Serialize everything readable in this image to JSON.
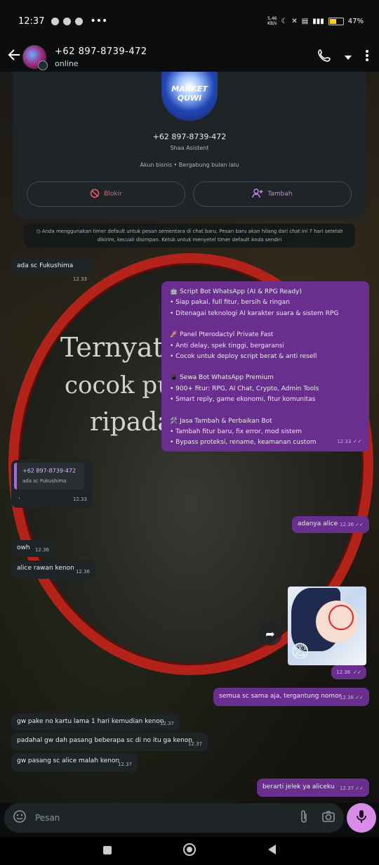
{
  "status_bar": {
    "time": "12:37",
    "network_speed": "5,46\nKB/s",
    "battery": "47%"
  },
  "header": {
    "contact": "+62 897-8739-472",
    "status": "online"
  },
  "business_card": {
    "logo_text": "MARKET QUWI",
    "phone": "+62 897-8739-472",
    "description": "Shaa Asistent",
    "info": "Akun bisnis • Bergabung bulan lalu",
    "block_label": "Blokir",
    "add_label": "Tambah"
  },
  "system_notice": "Anda menggunakan timer default untuk pesan sementara di chat baru. Pesan baru akan hilang dari chat ini 7 hari setelah dikirim, kecuali disimpan. Ketuk untuk menyetel timer default Anda sendiri",
  "wallpaper_text": {
    "line1": "Ternyat",
    "line2": "cocok punya uang",
    "line3": "ripada punya pacar."
  },
  "messages": [
    {
      "id": "m1",
      "dir": "in",
      "text": "ada sc Fukushima",
      "time": "12.33"
    },
    {
      "id": "m2",
      "dir": "out",
      "time": "12.33",
      "lines": [
        "🤖 Script Bot WhatsApp (AI & RPG Ready)",
        "• Siap pakai, full fitur, bersih & ringan",
        "• Ditenagai teknologi AI karakter suara & sistem RPG",
        "",
        "🚀 Panel Pterodactyl Private Fast",
        "• Anti delay, spek tinggi, bergaransi",
        "• Cocok untuk deploy script berat & anti resell",
        "",
        "📱 Sewa Bot WhatsApp Premium",
        "• 900+ fitur: RPG, AI Chat, Crypto, Admin Tools",
        "• Smart reply, game ekonomi, fitur komunitas",
        "",
        "🛠️ Jasa Tambah & Perbaikan Bot",
        "• Tambah fitur baru, fix error, mod sistem",
        "• Bypass proteksi, rename, keamanan custom"
      ]
    },
    {
      "id": "m3",
      "dir": "in",
      "text": ".",
      "time": "12.33",
      "reply_to": {
        "author": "+62 897-8739-472",
        "text": "ada sc Fukushima"
      }
    },
    {
      "id": "m4",
      "dir": "out",
      "text": "adanya alice",
      "time": "12.36"
    },
    {
      "id": "m5",
      "dir": "in",
      "text": "owh",
      "time": "12.36"
    },
    {
      "id": "m6",
      "dir": "in",
      "text": "alice rawan kenon",
      "time": "12.36"
    },
    {
      "id": "m7",
      "dir": "out",
      "type": "image",
      "time": "12.36",
      "emoji": "😨"
    },
    {
      "id": "m8",
      "dir": "out",
      "text": "semua sc sama aja, tergantung nomor",
      "time": "12.36"
    },
    {
      "id": "m9",
      "dir": "in",
      "text": "gw pake no kartu lama 1 hari kemudian kenon",
      "time": "12.37"
    },
    {
      "id": "m10",
      "dir": "in",
      "text": "padahal gw dah pasang beberapa sc di no itu ga kenon",
      "time": "12.37"
    },
    {
      "id": "m11",
      "dir": "in",
      "text": "gw pasang sc alice malah kenon",
      "time": "12.37"
    },
    {
      "id": "m12",
      "dir": "out",
      "text": "berarti jelek ya aliceku",
      "time": "12.37"
    }
  ],
  "input": {
    "placeholder": "Pesan"
  },
  "colors": {
    "outgoing": "#6a2e8f",
    "incoming": "#1f2427",
    "accent": "#d98ce8",
    "block_red": "#f15c6d"
  }
}
